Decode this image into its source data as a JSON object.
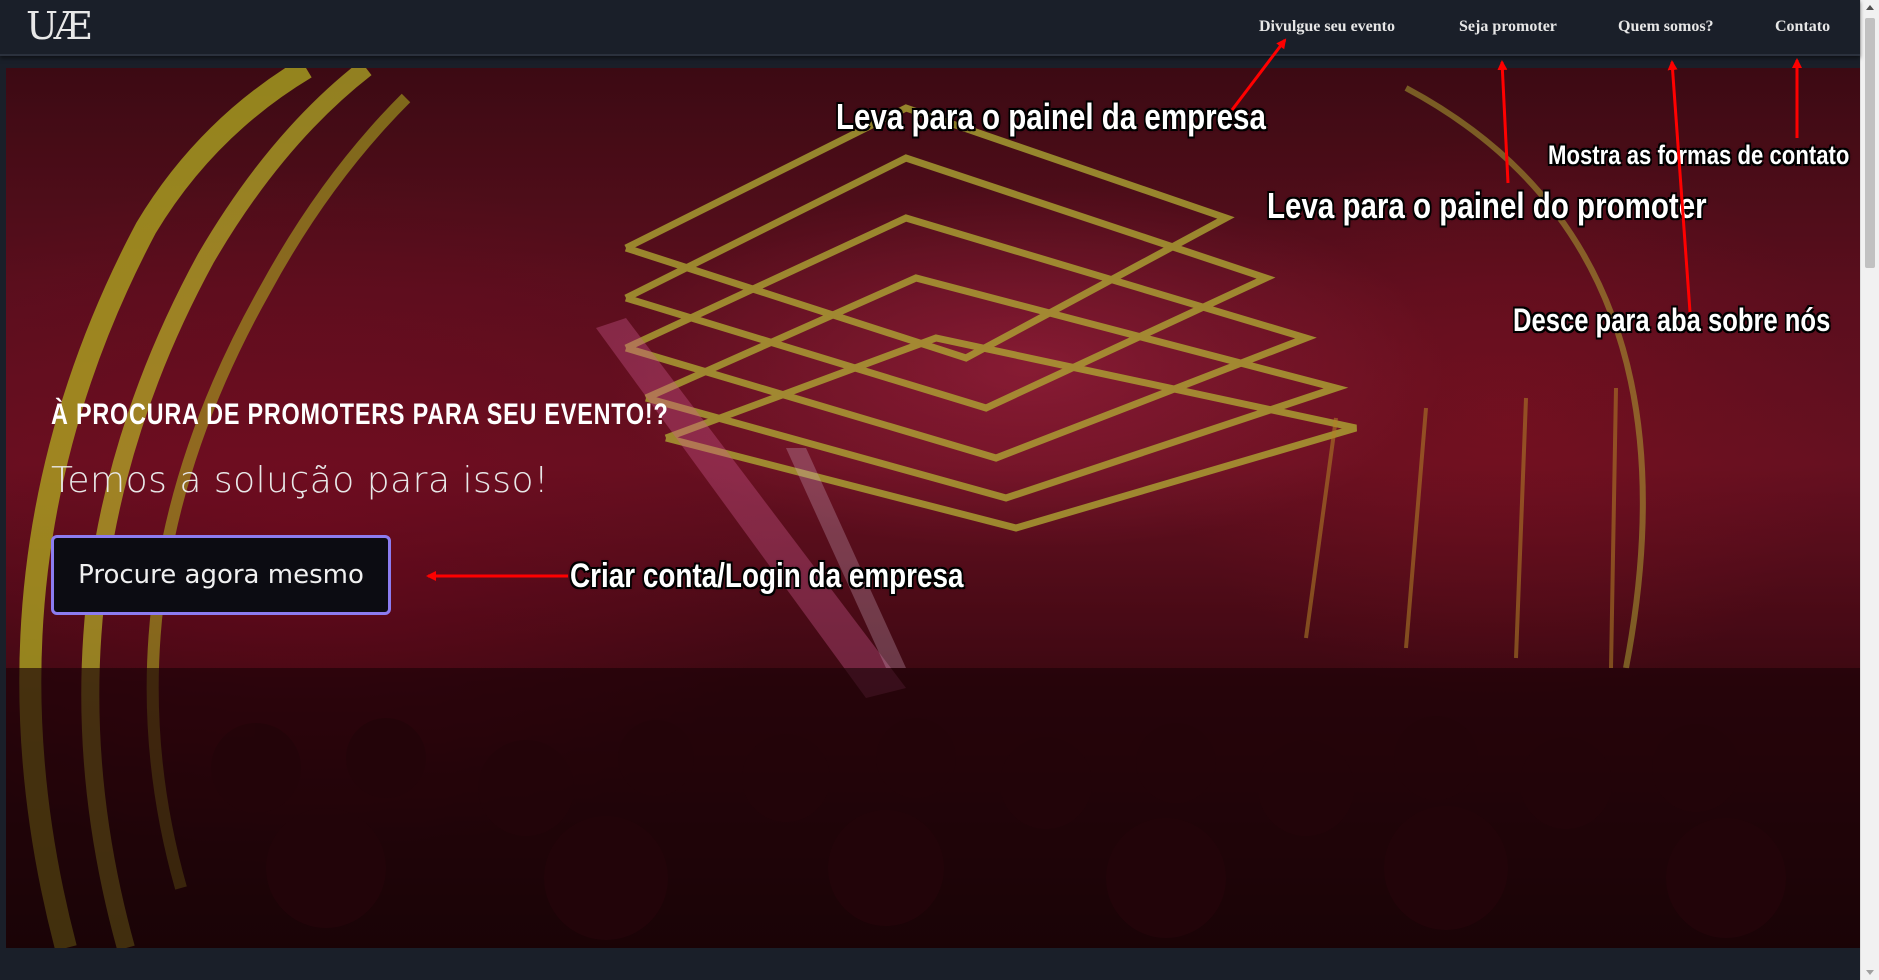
{
  "navbar": {
    "logo": "UÆ",
    "links": [
      {
        "label": "Divulgue seu evento"
      },
      {
        "label": "Seja promoter"
      },
      {
        "label": "Quem somos?"
      },
      {
        "label": "Contato"
      }
    ]
  },
  "hero": {
    "title": "À procura de promoters para seu evento!?",
    "subtitle": "Temos a solução para isso!",
    "cta_label": "Procure agora mesmo"
  },
  "annotations": {
    "painel_empresa": "Leva para o painel da empresa",
    "formas_contato": "Mostra as formas de contato",
    "painel_promoter": "Leva para o painel do promoter",
    "sobre_nos": "Desce para aba sobre nós",
    "criar_conta": "Criar conta/Login da empresa"
  },
  "colors": {
    "nav_bg": "#1a1f29",
    "cta_border": "#8c7cf0",
    "arrow": "#ff0000"
  }
}
